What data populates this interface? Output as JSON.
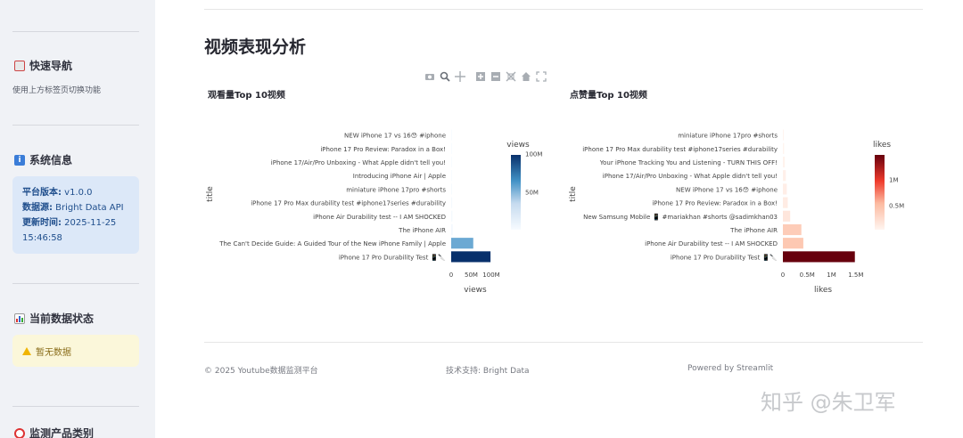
{
  "sidebar": {
    "quick_nav": {
      "title": "快速导航",
      "caption": "使用上方标签页切换功能"
    },
    "system_info": {
      "title": "系统信息",
      "version_label": "平台版本:",
      "version_value": " v1.0.0",
      "source_label": "数据源:",
      "source_value": " Bright Data API",
      "updated_label": "更新时间:",
      "updated_value": " 2025-11-25",
      "updated_time": "15:46:58"
    },
    "data_status": {
      "title": "当前数据状态",
      "warning": "暂无数据"
    },
    "product_category": {
      "title": "监测产品类别"
    }
  },
  "main": {
    "title": "视频表现分析",
    "toolbar_icons": [
      "camera-icon",
      "zoom-icon",
      "pan-icon",
      "zoom-in-icon",
      "zoom-out-icon",
      "autoscale-icon",
      "home-icon",
      "fullscreen-icon"
    ]
  },
  "footer": {
    "copyright": "© 2025 Youtube数据监测平台",
    "support": "技术支持: Bright Data",
    "powered": "Powered by Streamlit"
  },
  "watermark": "知乎 @朱卫军",
  "chart_data": [
    {
      "type": "bar",
      "orientation": "horizontal",
      "title": "观看量Top 10视频",
      "xlabel": "views",
      "ylabel": "title",
      "colorbar_title": "views",
      "colorscale": "Blues",
      "xlim": [
        0,
        120000000
      ],
      "xticks": [
        "0",
        "50M",
        "100M"
      ],
      "colorbar_ticks": [
        "100M",
        "50M"
      ],
      "categories": [
        "NEW iPhone 17 vs 16😯 #iphone",
        "iPhone 17 Pro Review: Paradox in a Box!",
        "iPhone 17/Air/Pro Unboxing - What Apple didn't tell you!",
        "Introducing iPhone Air | Apple",
        "miniature iPhone 17pro #shorts",
        "iPhone 17 Pro Max durability test #iphone17series #durability",
        "iPhone Air Durability test -- I AM SHOCKED",
        "The iPhone AIR",
        "The Can't Decide Guide: A Guided Tour of the New iPhone Family | Apple",
        "iPhone 17 Pro Durability Test 📱🔪"
      ],
      "values": [
        900000,
        1000000,
        1200000,
        1800000,
        2000000,
        2500000,
        3000000,
        4000000,
        55000000,
        98000000
      ]
    },
    {
      "type": "bar",
      "orientation": "horizontal",
      "title": "点赞量Top 10视频",
      "xlabel": "likes",
      "ylabel": "title",
      "colorbar_title": "likes",
      "colorscale": "Reds",
      "xlim": [
        0,
        1650000
      ],
      "xticks": [
        "0",
        "0.5M",
        "1M",
        "1.5M"
      ],
      "colorbar_ticks": [
        "1M",
        "0.5M"
      ],
      "categories": [
        "miniature iPhone 17pro #shorts",
        "iPhone 17 Pro Max durability test #iphone17series #durability",
        "Your iPhone Tracking You and Listening - TURN THIS OFF!",
        "iPhone 17/Air/Pro Unboxing - What Apple didn't tell you!",
        "NEW iPhone 17 vs 16😯 #iphone",
        "iPhone 17 Pro Review: Paradox in a Box!",
        "New Samsung Mobile 📱 #mariakhan #shorts @sadimkhan03",
        "The iPhone AIR",
        "iPhone Air Durability test -- I AM SHOCKED",
        "iPhone 17 Pro Durability Test 📱🔪"
      ],
      "values": [
        20000,
        25000,
        40000,
        60000,
        80000,
        100000,
        150000,
        380000,
        420000,
        1480000
      ]
    }
  ]
}
